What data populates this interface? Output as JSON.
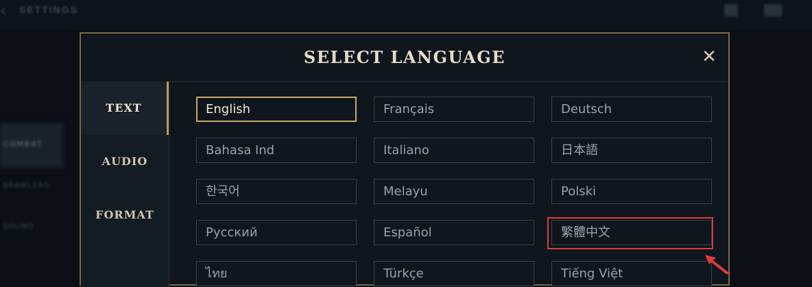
{
  "background": {
    "title": "SETTINGS",
    "back_icon": "chevron-left-icon",
    "side_items": [
      "COMBAT",
      "BRAWLERS",
      "SOUND"
    ]
  },
  "modal": {
    "title": "SELECT LANGUAGE",
    "close_icon": "close-icon",
    "close_label": "✕",
    "tabs": [
      {
        "label": "TEXT",
        "active": true
      },
      {
        "label": "AUDIO",
        "active": false
      },
      {
        "label": "FORMAT",
        "active": false
      }
    ],
    "languages": [
      {
        "label": "English",
        "selected": true
      },
      {
        "label": "Français"
      },
      {
        "label": "Deutsch"
      },
      {
        "label": "Bahasa Ind"
      },
      {
        "label": "Italiano"
      },
      {
        "label": "日本語"
      },
      {
        "label": "한국어"
      },
      {
        "label": "Melayu"
      },
      {
        "label": "Polski"
      },
      {
        "label": "Русский"
      },
      {
        "label": "Español"
      },
      {
        "label": "繁體中文"
      },
      {
        "label": "ไทย"
      },
      {
        "label": "Türkçe"
      },
      {
        "label": "Tiếng Việt"
      }
    ]
  },
  "annotation": {
    "color": "#e03a3a",
    "highlighted_language": "繁體中文"
  },
  "colors": {
    "accent_gold": "#c8aa6e",
    "modal_border": "#7a6a45",
    "background": "#0b1016"
  }
}
